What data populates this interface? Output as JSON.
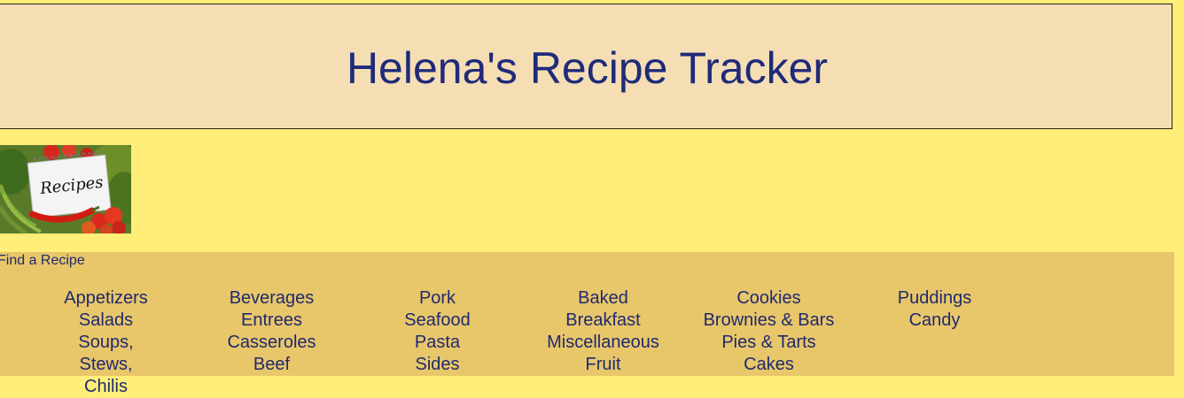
{
  "header": {
    "title": "Helena's Recipe Tracker"
  },
  "banner": {
    "notepad_text": "Recipes"
  },
  "find": {
    "label": "Find a Recipe",
    "columns": [
      [
        "Appetizers",
        "Salads",
        "Soups, Stews, Chilis"
      ],
      [
        "Beverages",
        "Entrees",
        "Casseroles",
        "Beef"
      ],
      [
        "Pork",
        "Seafood",
        "Pasta",
        "Sides"
      ],
      [
        "Baked",
        "Breakfast",
        "Miscellaneous",
        "Fruit"
      ],
      [
        "Cookies",
        "Brownies & Bars",
        "Pies & Tarts",
        "Cakes"
      ],
      [
        "Puddings",
        "Candy"
      ]
    ]
  },
  "colors": {
    "page_background": "#ffee77",
    "header_background": "#f5deb3",
    "find_background": "#e8c66a",
    "text": "#1f2a6e"
  }
}
